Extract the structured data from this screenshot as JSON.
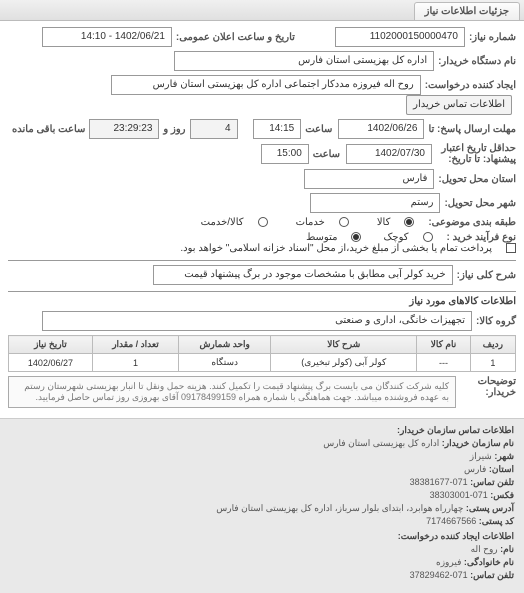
{
  "tab": {
    "label": "جزئیات اطلاعات نیاز"
  },
  "form": {
    "request_no_label": "شماره نیاز:",
    "request_no": "1102000150000470",
    "announce_label": "تاریخ و ساعت اعلان عمومی:",
    "announce_value": "1402/06/21 - 14:10",
    "buyer_org_label": "نام دستگاه خریدار:",
    "buyer_org": "اداره کل بهزیستی استان فارس",
    "creator_label": "ایجاد کننده درخواست:",
    "creator": "روح اله فیروزه مددکار اجتماعی اداره کل بهزیستی استان فارس",
    "creator_btn": "اطلاعات تماس خریدار",
    "deadline_label": "مهلت ارسال پاسخ: تا",
    "deadline_date": "1402/06/26",
    "deadline_time_lbl": "ساعت",
    "deadline_time": "14:15",
    "days_lbl": "روز و",
    "days": "4",
    "remaining": "23:29:23",
    "remaining_suffix": "ساعت باقی مانده",
    "validity_label": "حداقل تاریخ اعتبار پیشنهاد: تا تاریخ:",
    "validity_date": "1402/07/30",
    "validity_time_lbl": "ساعت",
    "validity_time": "15:00",
    "province_label": "استان محل تحویل:",
    "province": "فارس",
    "city_label": "شهر محل تحویل:",
    "city": "رستم",
    "category_label": "طبقه بندی موضوعی:",
    "cat_kala": "کالا",
    "cat_khadamat": "خدمات",
    "cat_kalakhadmat": "کالا/خدمت",
    "purchase_process_label": "نوع فرآیند خرید :",
    "purchase_small": "کوچک",
    "purchase_mid": "متوسط",
    "mid_note": "پرداخت تمام یا بخشی از مبلغ خرید،از محل \"اسناد خزانه اسلامی\" خواهد بود.",
    "desc_label": "شرح کلی نیاز:",
    "desc_value": "خرید کولر آبی مطابق با مشخصات موجود در برگ پیشنهاد قیمت"
  },
  "goods": {
    "section_title": "اطلاعات کالاهای مورد نیاز",
    "group_label": "گروه کالا:",
    "group_value": "تجهیزات خانگی، اداری و صنعتی",
    "headers": {
      "row": "ردیف",
      "name": "نام کالا",
      "desc": "شرح کالا",
      "unit": "واحد شمارش",
      "qty": "تعداد / مقدار",
      "date": "تاریخ نیاز"
    },
    "rows": [
      {
        "row": "1",
        "name": "---",
        "desc": "کولر آبی (کولر تبخیری)",
        "unit": "دستگاه",
        "qty": "1",
        "date": "1402/06/27"
      }
    ]
  },
  "notes": {
    "label": "توضیحات خریدار:",
    "text": "کلیه شرکت کنندگان می بایست برگ پیشنهاد قیمت را تکمیل کنند. هزینه حمل ونقل تا انبار بهزیستی شهرستان رستم به عهده فروشنده میباشد. جهت هماهنگی با شماره همراه 09178499159 آقای بهروزی روز تماس حاصل فرمایید."
  },
  "footer": {
    "section_title": "اطلاعات تماس سازمان خریدار:",
    "org_label": "نام سازمان خریدار:",
    "org": "اداره کل بهزیستی استان فارس",
    "city_label": "شهر:",
    "city": "شیراز",
    "province_label": "استان:",
    "province": "فارس",
    "tel_label": "تلفن تماس:",
    "tel": "071-38381677",
    "fax_label": "فکس:",
    "fax": "071-38303001",
    "address_label": "آدرس پستی:",
    "address": "چهارراه هوابرد، ابتدای بلوار سرباز، اداره کل بهزیستی استان فارس",
    "zip_label": "کد پستی:",
    "zip": "7174667566",
    "creator_section": "اطلاعات ایجاد کننده درخواست:",
    "cname_label": "نام:",
    "cname": "روح اله",
    "clast_label": "نام خانوادگی:",
    "clast": "فیروزه",
    "cphone_label": "تلفن تماس:",
    "cphone": "071-37829462"
  }
}
